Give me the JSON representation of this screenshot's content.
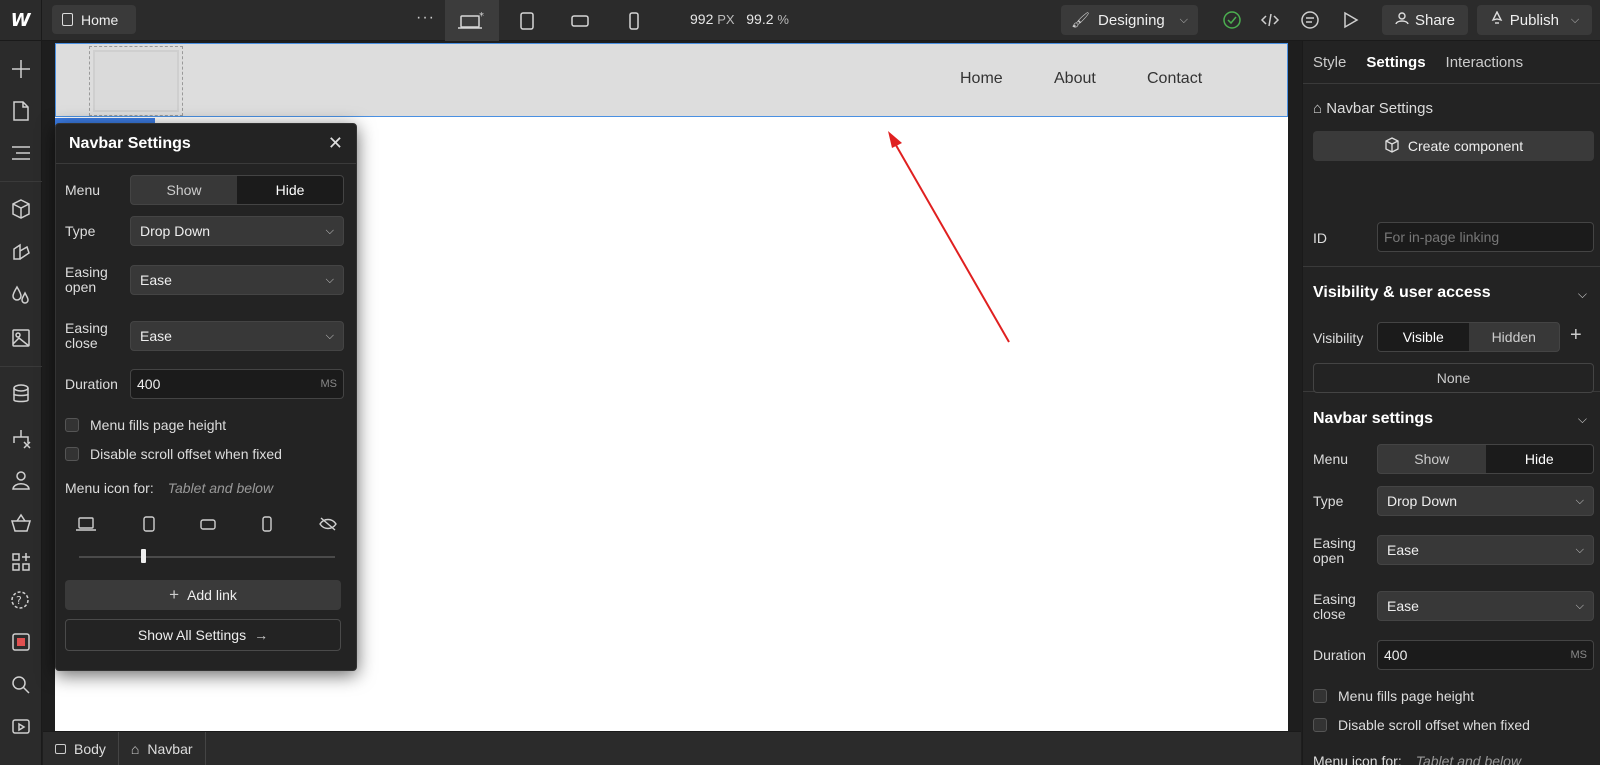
{
  "topbar": {
    "page_name": "Home",
    "more": "···",
    "size_value": "992",
    "size_unit": "PX",
    "zoom_value": "99.2",
    "zoom_unit": "%",
    "mode_label": "Designing",
    "share_label": "Share",
    "publish_label": "Publish"
  },
  "canvas": {
    "nav_links": [
      "Home",
      "About",
      "Contact"
    ]
  },
  "popover": {
    "title": "Navbar Settings",
    "menu_label": "Menu",
    "menu_options": [
      "Show",
      "Hide"
    ],
    "menu_selected": "Hide",
    "type_label": "Type",
    "type_value": "Drop Down",
    "easing_open_label": "Easing open",
    "easing_open_value": "Ease",
    "easing_close_label": "Easing close",
    "easing_close_value": "Ease",
    "duration_label": "Duration",
    "duration_value": "400",
    "duration_unit": "MS",
    "fills_label": "Menu fills page height",
    "scroll_label": "Disable scroll offset when fixed",
    "menu_icon_label": "Menu icon for:",
    "menu_icon_value": "Tablet and below",
    "add_link_label": "Add link",
    "show_all_label": "Show All Settings"
  },
  "rpanel": {
    "tabs": [
      "Style",
      "Settings",
      "Interactions"
    ],
    "active_tab": "Settings",
    "crumb_title": "Navbar Settings",
    "create_component": "Create component",
    "id_label": "ID",
    "id_placeholder": "For in-page linking",
    "visibility_heading": "Visibility & user access",
    "visibility_label": "Visibility",
    "visibility_options": [
      "Visible",
      "Hidden"
    ],
    "visibility_selected": "Visible",
    "access_value": "None",
    "navbar_heading": "Navbar settings",
    "menu_label": "Menu",
    "menu_options": [
      "Show",
      "Hide"
    ],
    "type_label": "Type",
    "type_value": "Drop Down",
    "easing_open_label": "Easing open",
    "easing_open_value": "Ease",
    "easing_close_label": "Easing close",
    "easing_close_value": "Ease",
    "duration_label": "Duration",
    "duration_value": "400",
    "duration_unit": "MS",
    "fills_label": "Menu fills page height",
    "scroll_label": "Disable scroll offset when fixed",
    "menu_icon_label": "Menu icon for:",
    "menu_icon_value": "Tablet and below"
  },
  "breadcrumb": {
    "items": [
      "Body",
      "Navbar"
    ]
  },
  "colors": {
    "accent_blue": "#3c7de6",
    "annotation_arrow": "#e02020",
    "status_check": "#4caf50"
  }
}
